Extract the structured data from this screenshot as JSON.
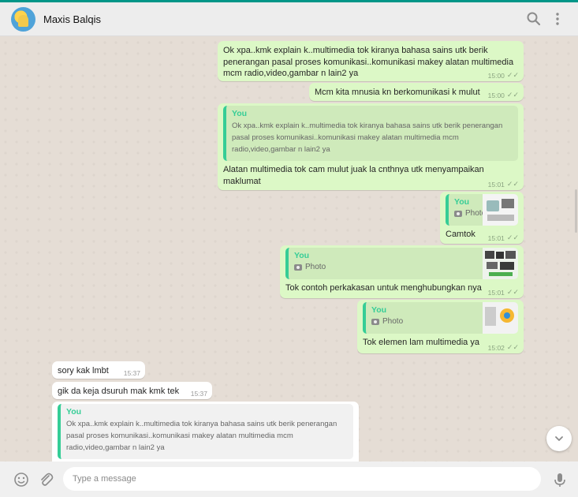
{
  "header": {
    "contact_name": "Maxis Balqis",
    "icons": [
      "search-icon",
      "menu-icon"
    ]
  },
  "messages": [
    {
      "direction": "out",
      "text": "Ok xpa..kmk explain k..multimedia tok kiranya bahasa sains utk berik penerangan pasal proses komunikasi..komunikasi makey alatan multimedia mcm radio,video,gambar n lain2 ya",
      "time": "15:00"
    },
    {
      "direction": "out",
      "text": "Mcm kita mnusia kn berkomunikasi k mulut",
      "time": "15:00"
    },
    {
      "direction": "out",
      "quote_author": "You",
      "quote_text": "Ok xpa..kmk explain k..multimedia tok kiranya bahasa sains utk berik penerangan pasal proses komunikasi..komunikasi makey alatan multimedia mcm radio,video,gambar n lain2 ya",
      "text": "Alatan multimedia tok cam mulut juak la cnthnya utk menyampaikan maklumat",
      "time": "15:01"
    },
    {
      "direction": "out",
      "quote_author": "You",
      "quote_type": "Photo",
      "text": "Camtok",
      "time": "15:01"
    },
    {
      "direction": "out",
      "quote_author": "You",
      "quote_type": "Photo",
      "text": "Tok contoh perkakasan untuk menghubungkan nya",
      "time": "15:01"
    },
    {
      "direction": "out",
      "quote_author": "You",
      "quote_type": "Photo",
      "text": "Tok elemen lam multimedia ya",
      "time": "15:02"
    },
    {
      "direction": "in",
      "text": "sory kak lmbt",
      "time": "15:37"
    },
    {
      "direction": "in",
      "text": "gik da keja dsuruh mak kmk tek",
      "time": "15:37"
    },
    {
      "direction": "in",
      "quote_author": "You",
      "quote_text": "Ok xpa..kmk explain k..multimedia tok kiranya bahasa sains utk berik penerangan pasal proses komunikasi..komunikasi makey alatan multimedia mcm radio,video,gambar n lain2 ya"
    }
  ],
  "footer": {
    "input_placeholder": "Type a message",
    "icons": [
      "emoji-icon",
      "attach-icon",
      "microphone-icon"
    ]
  },
  "colors": {
    "outgoing": "#dcf8c6",
    "incoming": "#ffffff",
    "quote_accent": "#35cd96",
    "header": "#ededed",
    "background": "#e5ddd5",
    "top_accent": "#009688"
  }
}
